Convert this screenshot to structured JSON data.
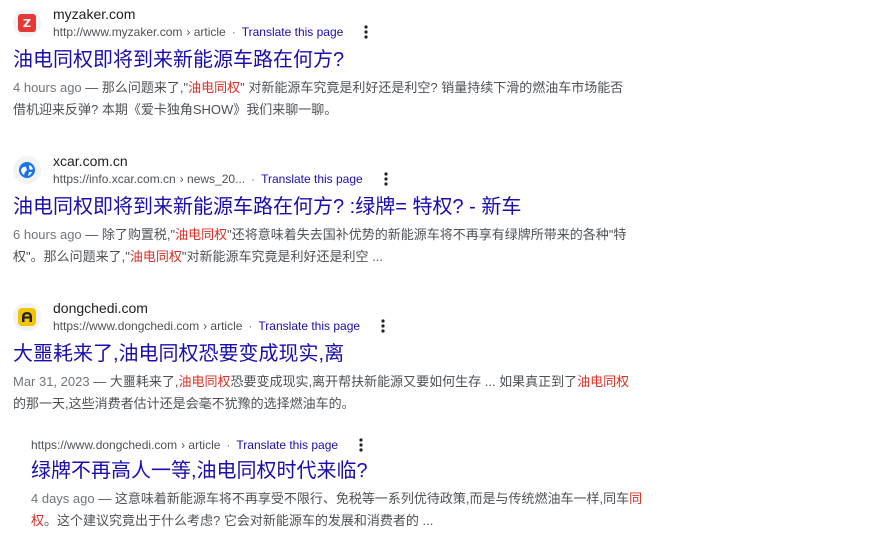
{
  "results": [
    {
      "site": "myzaker.com",
      "url": "http://www.myzaker.com",
      "path": "› article",
      "translate": "Translate this page",
      "title": "油电同权即将到来新能源车路在何方?",
      "date": "4 hours ago",
      "dash": " — ",
      "snippet": [
        {
          "t": "那么问题来了,\"",
          "h": false
        },
        {
          "t": "油电同权",
          "h": true
        },
        {
          "t": "\" 对新能源车究竟是利好还是利空? 销量持续下滑的燃油车市场能否借机迎来反弹? 本期《爱卡独角SHOW》我们来聊一聊。",
          "h": false
        }
      ],
      "icon": "zaker-logo-icon"
    },
    {
      "site": "xcar.com.cn",
      "url": "https://info.xcar.com.cn",
      "path": "› news_20...",
      "translate": "Translate this page",
      "title": "油电同权即将到来新能源车路在何方? :绿牌= 特权? - 新车",
      "date": "6 hours ago",
      "dash": " — ",
      "snippet": [
        {
          "t": "除了购置税,\"",
          "h": false
        },
        {
          "t": "油电同权",
          "h": true
        },
        {
          "t": "\"还将意味着失去国补优势的新能源车将不再享有绿牌所带来的各种\"特权\"。那么问题来了,\"",
          "h": false
        },
        {
          "t": "油电同权",
          "h": true
        },
        {
          "t": "\"对新能源车究竟是利好还是利空 ...",
          "h": false
        }
      ],
      "icon": "globe-icon"
    },
    {
      "site": "dongchedi.com",
      "url": "https://www.dongchedi.com",
      "path": "› article",
      "translate": "Translate this page",
      "title": "大噩耗来了,油电同权恐要变成现实,离",
      "date": "Mar 31, 2023",
      "dash": " — ",
      "snippet": [
        {
          "t": "大噩耗来了,",
          "h": false
        },
        {
          "t": "油电同权",
          "h": true
        },
        {
          "t": "恐要变成现实,离开帮扶新能源又要如何生存 ... 如果真正到了",
          "h": false
        },
        {
          "t": "油电同权",
          "h": true
        },
        {
          "t": "的那一天,这些消费者估计还是会毫不犹豫的选择燃油车的。",
          "h": false
        }
      ],
      "icon": "dongchedi-logo-icon"
    },
    {
      "site": "",
      "url": "https://www.dongchedi.com",
      "path": "› article",
      "translate": "Translate this page",
      "title": "绿牌不再高人一等,油电同权时代来临?",
      "date": "4 days ago",
      "dash": " — ",
      "snippet": [
        {
          "t": "这意味着新能源车将不再享受不限行、免税等一系列优待政策,而是与传统燃油车一样,同车",
          "h": false
        },
        {
          "t": "同权",
          "h": true
        },
        {
          "t": "。这个建议究竟出于什么考虑? 它会对新能源车的发展和消费者的 ...",
          "h": false
        }
      ],
      "icon": ""
    }
  ],
  "colors": {
    "link": "#1a0dab",
    "highlight": "#d93025",
    "zaker": "#e53935",
    "dongchedi": "#f5c400"
  }
}
